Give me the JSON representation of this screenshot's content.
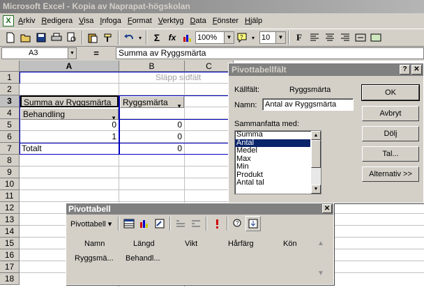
{
  "window": {
    "title": "Microsoft Excel - Kopia av Naprapat-högskolan"
  },
  "menu": [
    "Arkiv",
    "Redigera",
    "Visa",
    "Infoga",
    "Format",
    "Verktyg",
    "Data",
    "Fönster",
    "Hjälp"
  ],
  "toolbar": {
    "zoom": "100%",
    "fontsize": "10"
  },
  "formula_bar": {
    "cell_ref": "A3",
    "equals": "=",
    "content": "Summa av Ryggsmärta"
  },
  "columns": [
    "A",
    "B",
    "C"
  ],
  "rows": [
    "1",
    "2",
    "3",
    "4",
    "5",
    "6",
    "7",
    "8",
    "9",
    "10",
    "11",
    "12",
    "13",
    "14",
    "15",
    "16",
    "17",
    "18"
  ],
  "sheet": {
    "drop_page_field": "Släpp sidfält",
    "a3": "Summa av Ryggsmärta",
    "b3": "Ryggsmärta",
    "a4": "Behandling",
    "a5": "0",
    "b5": "0",
    "a6": "1",
    "b6": "0",
    "a7": "Totalt",
    "b7": "0"
  },
  "dialog": {
    "title": "Pivottabellfält",
    "help": "?",
    "close": "✕",
    "source_label": "Källfält:",
    "source_value": "Ryggsmärta",
    "name_label": "Namn:",
    "name_value": "Antal av Ryggsmärta",
    "summarize_label": "Sammanfatta med:",
    "options": [
      "Summa",
      "Antal",
      "Medel",
      "Max",
      "Min",
      "Produkt",
      "Antal tal"
    ],
    "selected_option": "Antal",
    "buttons": {
      "ok": "OK",
      "cancel": "Avbryt",
      "hide": "Dölj",
      "number": "Tal...",
      "advanced": "Alternativ >>"
    }
  },
  "pivot_toolbar": {
    "title": "Pivottabell",
    "close": "✕",
    "menu": "Pivottabell ▾",
    "fields_row1": [
      "Namn",
      "Längd",
      "Vikt",
      "Hårfärg",
      "Kön"
    ],
    "fields_row2": [
      "Ryggsmä...",
      "Behandl..."
    ]
  }
}
